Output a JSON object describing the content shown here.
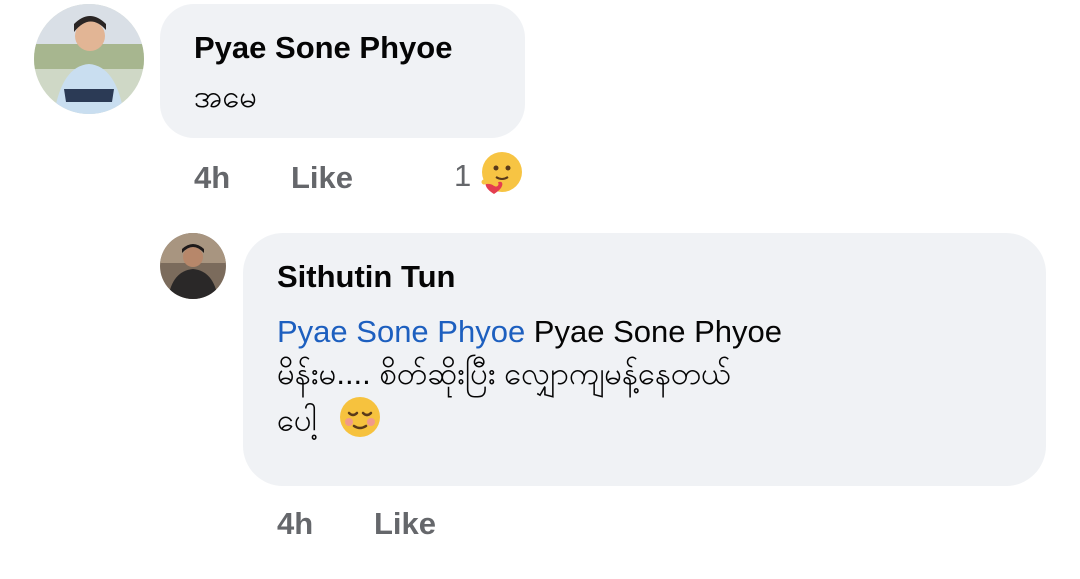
{
  "comments": [
    {
      "author": "Pyae Sone Phyoe",
      "text": "အမေ",
      "time": "4h",
      "like_label": "Like",
      "reaction_count": "1",
      "reaction_icon": "care-reaction-icon"
    }
  ],
  "reply": {
    "author": "Sithutin Tun",
    "mention": "Pyae Sone Phyoe",
    "text_line1": " Pyae Sone Phyoe",
    "text_line2": "မိန်းမ.... စိတ်ဆိုးပြီး လျှောကျမန့်နေတယ်",
    "text_line3": "ပေါ့",
    "emoji": "relieved-face-emoji",
    "time": "4h",
    "like_label": "Like"
  },
  "colors": {
    "bubble": "#f0f2f5",
    "mention": "#1d5fbf",
    "meta": "#65676b"
  }
}
